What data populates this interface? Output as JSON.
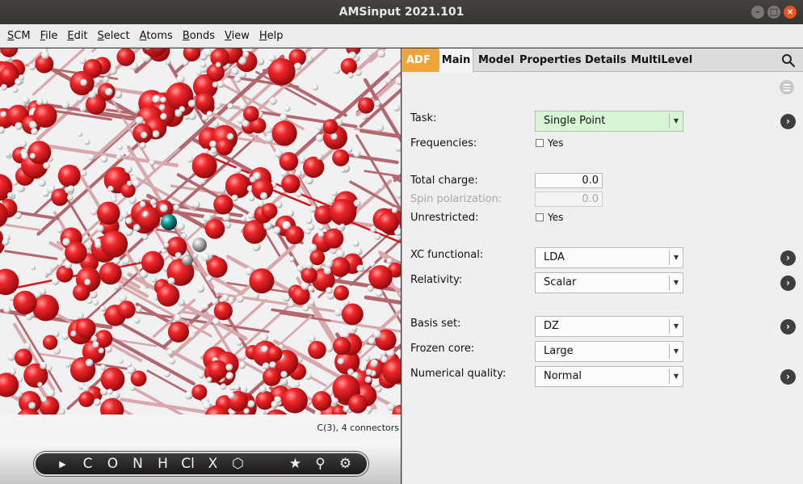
{
  "window": {
    "title": "AMSinput 2021.101"
  },
  "menubar": {
    "items": [
      {
        "first": "S",
        "rest": "CM"
      },
      {
        "first": "F",
        "rest": "ile"
      },
      {
        "first": "E",
        "rest": "dit"
      },
      {
        "first": "S",
        "rest": "elect"
      },
      {
        "first": "A",
        "rest": "toms"
      },
      {
        "first": "B",
        "rest": "onds"
      },
      {
        "first": "V",
        "rest": "iew"
      },
      {
        "first": "H",
        "rest": "elp"
      }
    ]
  },
  "viewer": {
    "status_text": "C(3), 4 connectors"
  },
  "toolbar": {
    "pointer": "▶",
    "carbon": "C",
    "oxygen": "O",
    "nitrogen": "N",
    "hydrogen": "H",
    "chlorine": "Cl",
    "other_element": "X",
    "ring": "⬡",
    "favorite": "★",
    "tool": "⚲",
    "settings": "⚙"
  },
  "tabs": {
    "engine": "ADF",
    "main": "Main",
    "model": "Model",
    "properties": "Properties",
    "details": "Details",
    "multilevel": "MultiLevel"
  },
  "form": {
    "task": {
      "label": "Task:",
      "value": "Single Point"
    },
    "frequencies": {
      "label": "Frequencies:",
      "option": "Yes",
      "checked": false
    },
    "total_charge": {
      "label": "Total charge:",
      "value": "0.0"
    },
    "spin_polarization": {
      "label": "Spin polarization:",
      "value": "0.0"
    },
    "unrestricted": {
      "label": "Unrestricted:",
      "option": "Yes",
      "checked": false
    },
    "xc_functional": {
      "label": "XC functional:",
      "value": "LDA"
    },
    "relativity": {
      "label": "Relativity:",
      "value": "Scalar"
    },
    "basis_set": {
      "label": "Basis set:",
      "value": "DZ"
    },
    "frozen_core": {
      "label": "Frozen core:",
      "value": "Large"
    },
    "numerical_quality": {
      "label": "Numerical quality:",
      "value": "Normal"
    }
  },
  "colors": {
    "accent_adf": "#f0a53b",
    "task_highlight": "#d7f7d4",
    "atom_oxygen": "#e3161c",
    "atom_hydrogen": "#f4f4f4",
    "bond": "#b06a74"
  }
}
